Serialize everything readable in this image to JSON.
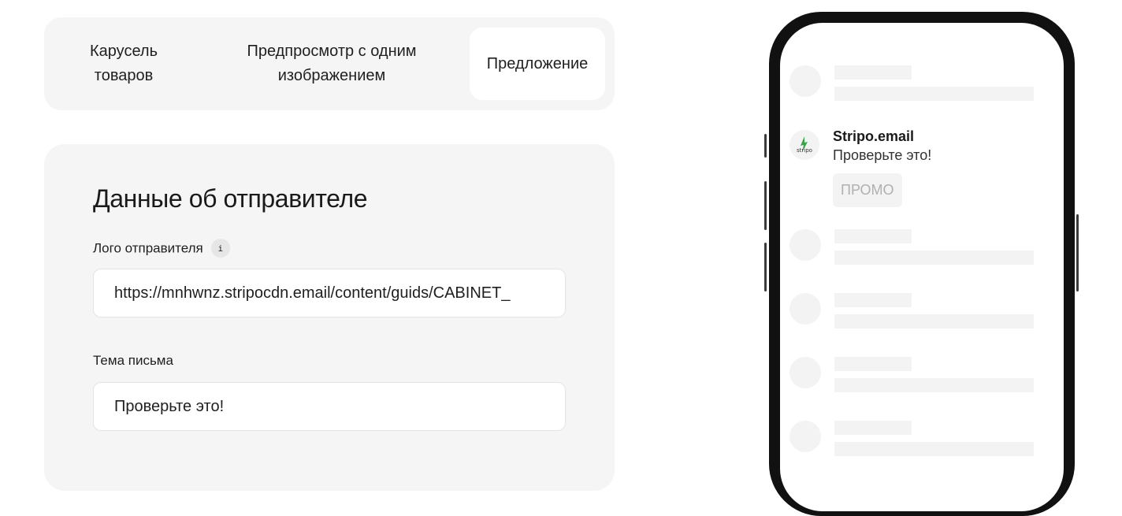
{
  "tabs": [
    {
      "label": "Карусель\nтоваров",
      "active": false
    },
    {
      "label": "Предпросмотр с одним\nизображением",
      "active": false
    },
    {
      "label": "Предложение",
      "active": true
    }
  ],
  "sender": {
    "title": "Данные об отправителе",
    "logo_label": "Лого отправителя",
    "info_icon": "i",
    "logo_value": "https://mnhwnz.stripocdn.email/content/guids/CABINET_",
    "subject_label": "Тема письма",
    "subject_value": "Проверьте это!"
  },
  "preview": {
    "sender_name": "Stripo.email",
    "subject": "Проверьте это!",
    "badge": "ПРОМО",
    "logo_text": "stripo"
  },
  "colors": {
    "panel_bg": "#f5f5f5",
    "phone_frame": "#111111",
    "placeholder": "#f3f3f3",
    "logo_green": "#3aa34a"
  }
}
